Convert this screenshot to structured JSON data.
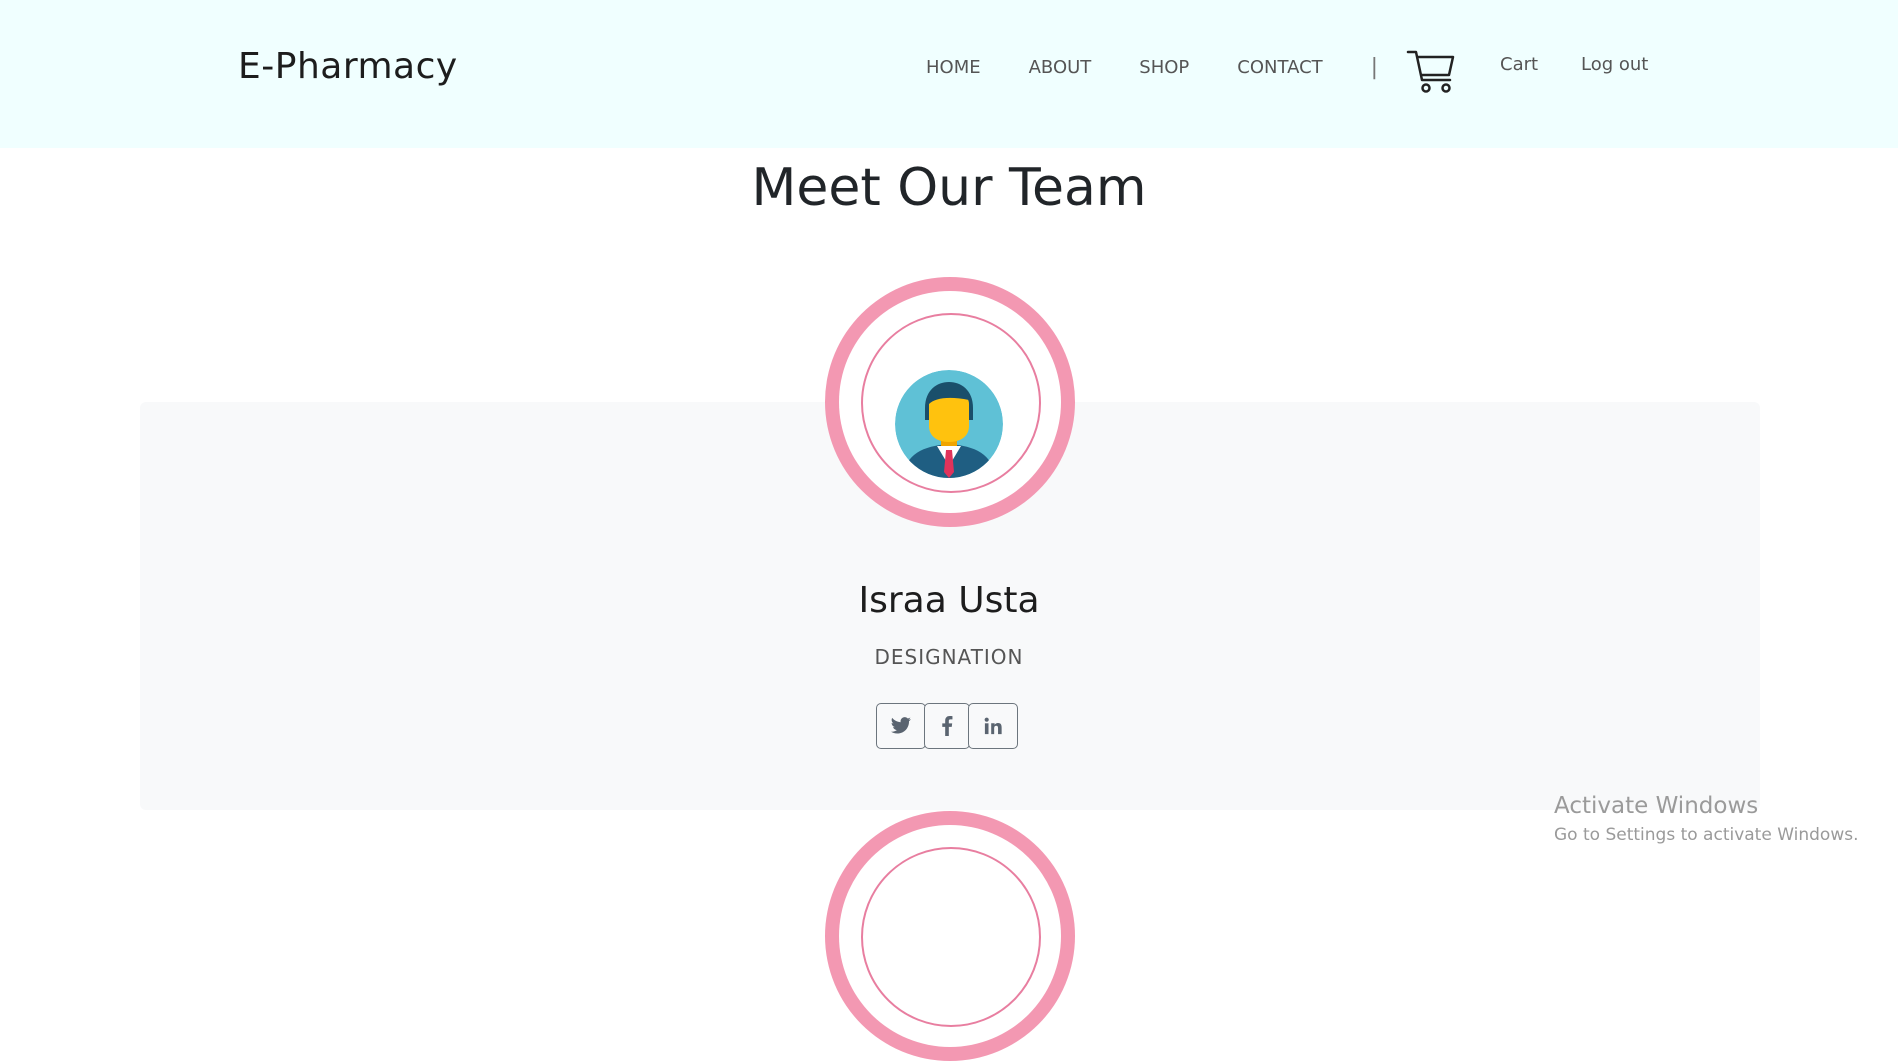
{
  "navbar": {
    "brand": "E-Pharmacy",
    "links": [
      "HOME",
      "ABOUT",
      "SHOP",
      "CONTACT"
    ],
    "separator": "|",
    "cart_label": "Cart",
    "logout_label": "Log out",
    "background": "#f0ffff"
  },
  "main": {
    "title": "Meet Our Team",
    "team": [
      {
        "name": "Israa Usta",
        "designation": "DESIGNATION",
        "social": [
          "twitter-icon",
          "facebook-icon",
          "linkedin-icon"
        ]
      }
    ],
    "accent_color": "#f398b2"
  },
  "watermark": {
    "title": "Activate Windows",
    "subtitle": "Go to Settings to activate Windows."
  }
}
